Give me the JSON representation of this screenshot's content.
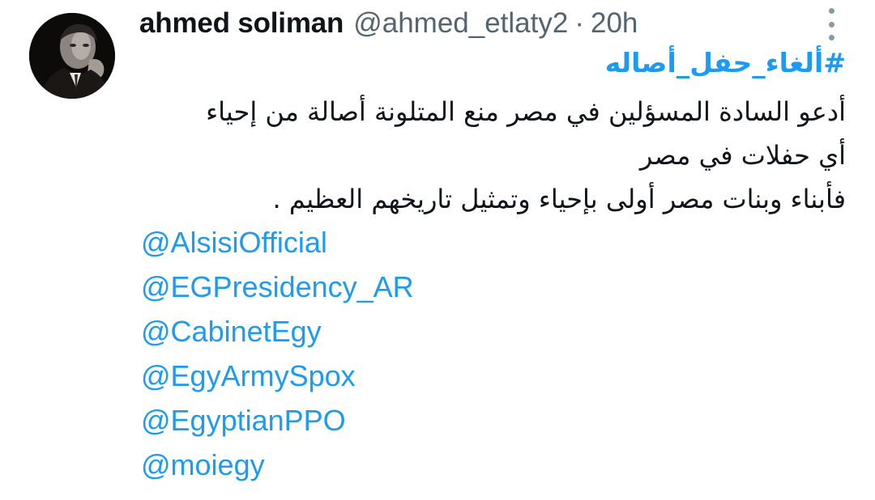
{
  "tweet": {
    "author": {
      "display_name": "ahmed soliman",
      "handle": "@ahmed_etlaty2",
      "separator": "·",
      "time": "20h",
      "avatar_icon": "profile-photo"
    },
    "more_icon": "vertical-ellipsis-icon",
    "hashtag": "#ألغاء_حفل_أصاله",
    "text_lines": [
      "أدعو السادة المسؤلين في مصر منع المتلونة أصالة من إحياء",
      "أي حفلات  في مصر",
      "فأبناء وبنات مصر أولى بإحياء وتمثيل تاريخهم العظيم ."
    ],
    "mentions": [
      "@AlsisiOfficial",
      "@EGPresidency_AR",
      "@CabinetEgy",
      "@EgyArmySpox",
      "@EgyptianPPO",
      "@moiegy"
    ]
  },
  "colors": {
    "link": "#1d9bf0",
    "text": "#0f1419",
    "secondary": "#536471",
    "background": "#ffffff"
  }
}
